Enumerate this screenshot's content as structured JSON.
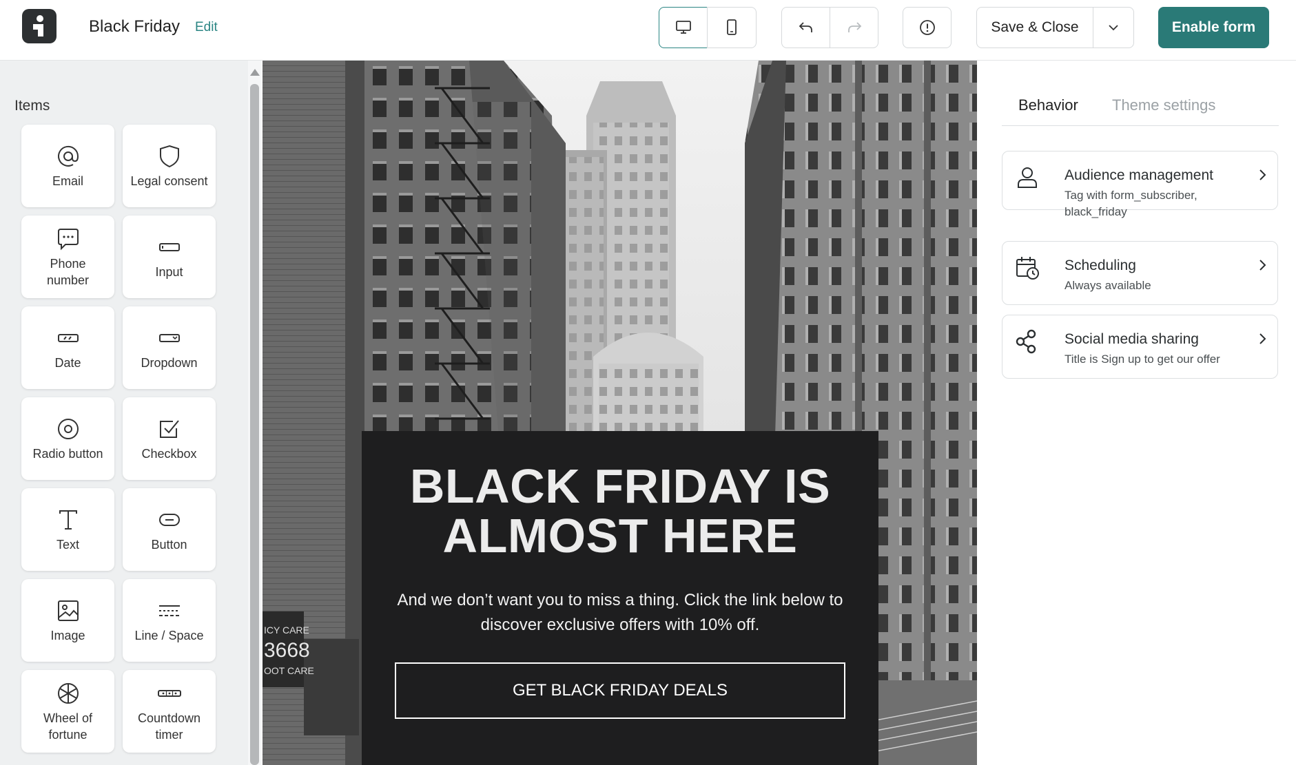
{
  "header": {
    "title": "Black Friday",
    "edit_label": "Edit",
    "save_label": "Save & Close",
    "enable_label": "Enable form",
    "icons": [
      "desktop-icon",
      "mobile-icon",
      "undo-icon",
      "redo-icon",
      "info-icon",
      "chevron-down-icon"
    ]
  },
  "sidebar": {
    "title": "Items",
    "items": [
      {
        "label": "Email",
        "icon": "at-icon"
      },
      {
        "label": "Legal consent",
        "icon": "shield-icon"
      },
      {
        "label": "Phone number",
        "icon": "chat-icon"
      },
      {
        "label": "Input",
        "icon": "input-icon"
      },
      {
        "label": "Date",
        "icon": "date-icon"
      },
      {
        "label": "Dropdown",
        "icon": "dropdown-icon"
      },
      {
        "label": "Radio button",
        "icon": "radio-icon"
      },
      {
        "label": "Checkbox",
        "icon": "checkbox-icon"
      },
      {
        "label": "Text",
        "icon": "text-icon"
      },
      {
        "label": "Button",
        "icon": "button-icon"
      },
      {
        "label": "Image",
        "icon": "image-icon"
      },
      {
        "label": "Line / Space",
        "icon": "line-space-icon"
      },
      {
        "label": "Wheel of fortune",
        "icon": "wheel-icon"
      },
      {
        "label": "Countdown timer",
        "icon": "countdown-icon"
      }
    ]
  },
  "canvas": {
    "heading_line1": "BLACK FRIDAY IS",
    "heading_line2": "ALMOST HERE",
    "body": "And we don’t want you to miss a thing. Click the link below to discover exclusive offers with 10% off.",
    "cta": "GET BLACK FRIDAY DEALS"
  },
  "panel": {
    "tabs": [
      {
        "label": "Behavior",
        "active": true
      },
      {
        "label": "Theme settings",
        "active": false
      }
    ],
    "cards": [
      {
        "title": "Audience management",
        "subtitle": "Tag with form_subscriber, black_friday",
        "icon": "user-icon"
      },
      {
        "title": "Scheduling",
        "subtitle": "Always available",
        "icon": "calendar-clock-icon"
      },
      {
        "title": "Social media sharing",
        "subtitle": "Title is Sign up to get our offer",
        "icon": "share-icon"
      }
    ]
  },
  "colors": {
    "accent": "#2a7a77",
    "link": "#2a8583",
    "form_background": "#1e1e1f",
    "sidebar_background": "#eef0f1"
  }
}
